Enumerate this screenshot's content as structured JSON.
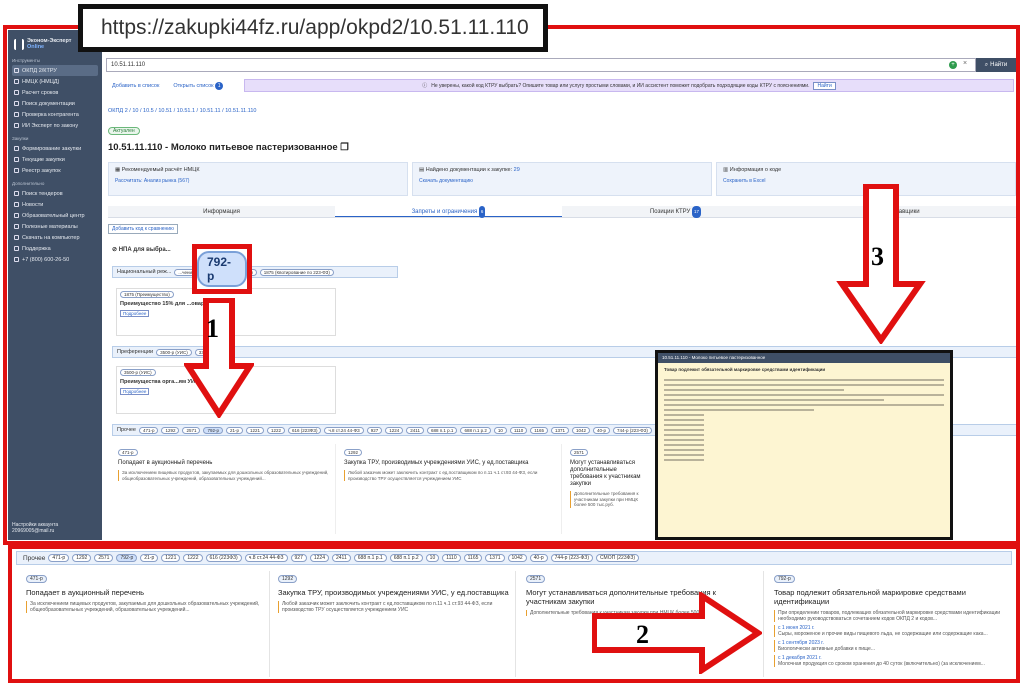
{
  "url": "https://zakupki44fz.ru/app/okpd2/10.51.11.110",
  "sidebar": {
    "logo_top": "Эконом-Эксперт",
    "logo_sub": "Online",
    "sections": {
      "tools": "Инструменты",
      "purchases": "Закупки",
      "extra": "Дополнительно"
    },
    "tools": [
      "ОКПД 2/КТРУ",
      "НМЦК (НМЦД)",
      "Расчет сроков",
      "Поиск документации",
      "Проверка контрагента",
      "ИИ Эксперт по закону"
    ],
    "purchases": [
      "Формирование закупки",
      "Текущие закупки",
      "Реестр закупок"
    ],
    "extra": [
      "Поиск тендеров",
      "Новости",
      "Образовательный центр",
      "Полезные материалы",
      "Скачать на компьютер",
      "Поддержка",
      "+7 (800) 600-26-50"
    ],
    "account_title": "Настройки аккаунта",
    "account_email": "20969005@mail.ru"
  },
  "search": {
    "value": "10.51.11.110",
    "button": "Найти"
  },
  "links": {
    "add": "Добавить в список",
    "open": "Открыть список",
    "open_count": "1"
  },
  "hint": {
    "text": "Не уверены, какой код КТРУ выбрать? Опишите товар или услугу простыми словами, и ИИ ассистент поможет подобрать подходящие коды КТРУ с пояснениями.",
    "button": "Найти"
  },
  "breadcrumbs": "ОКПД 2 / 10 / 10.5 / 10.51 / 10.51.1 / 10.51.11 / 10.51.11.110",
  "status": "Актуален",
  "title": "10.51.11.110 - Молоко питьевое пастеризованное",
  "cards": [
    {
      "title": "Рекомендуемый расчёт НМЦК",
      "link": "Рассчитать: Анализ рынка (567)"
    },
    {
      "title": "Найдено документации к закупке:",
      "count": "29",
      "link": "Скачать документацию"
    },
    {
      "title": "Информация о коде",
      "link": "Сохранить в Excel"
    }
  ],
  "tabs": [
    {
      "label": "Информация"
    },
    {
      "label": "Запреты и ограничения",
      "badge": "6"
    },
    {
      "label": "Позиции КТРУ",
      "badge": "17"
    },
    {
      "label": "Поставщики"
    }
  ],
  "add_compare": "Добавить код к сравнению",
  "npa_title": "НПА для выбра...",
  "national": {
    "label": "Национальный реж...",
    "chips": [
      "...чение)",
      "1875 (Преимущество)",
      "1875 (Квотирование по 223-ФЗ)"
    ]
  },
  "national_card": {
    "chip": "1875 (Преимущество)",
    "title": "Преимущество 15% для ...оваров",
    "btn": "Подробнее"
  },
  "preferences": {
    "label": "Преференции",
    "chips": [
      "3500-р (УИС)",
      "3387-р (ОИ)"
    ]
  },
  "pref_card": {
    "chip": "3500-р (УИС)",
    "title": "Преимущества орга...ям УИС",
    "btn": "Подробнее"
  },
  "other": {
    "label": "Прочее",
    "chips": [
      "471-р",
      "1292",
      "2571",
      "792-р",
      "21-р",
      "1221",
      "1222",
      "616 (223ФЗ)",
      "ч.8 ст.24 44-ФЗ",
      "927",
      "1224",
      "2411",
      "688 п.1 р.1",
      "688 п.1 р.2",
      "10",
      "1110",
      "1165",
      "1371",
      "1042",
      "40-р",
      "744-р (223-ФЗ)",
      "СМОП (223ФЗ)"
    ],
    "selected": "792-р"
  },
  "callout_chip": "792-р",
  "labels": {
    "one": "1",
    "two": "2",
    "three": "3"
  },
  "popup": {
    "title": "10.51.11.110 - Молоко питьевое пастеризованное",
    "heading": "Товар подлежит обязательной маркировке средствами идентификации"
  },
  "other_cards": [
    {
      "chip": "471-р",
      "title": "Попадает в аукционный перечень",
      "desc": "За исключением пищевых продуктов, закупаемых для дошкольных образовательных учреждений, общеобразовательных учреждений, образовательных учреждений..."
    },
    {
      "chip": "1292",
      "title": "Закупка ТРУ, производимых учреждениями УИС, у ед.поставщика",
      "desc": "Любой заказчик может заключить контракт с ед.поставщиком по п.11 ч.1 ст.93 44-ФЗ, если производство ТРУ осуществляется учреждением УИС"
    },
    {
      "chip": "2571",
      "title": "Могут устанавливаться дополнительные требования к участникам закупки",
      "desc": "Дополнительные требования к участникам закупки при НМЦК более 500 тыс.руб."
    },
    {
      "chip": "792-р",
      "title": "Товар подлежит обязательной маркировке средствами идентификации",
      "desc": "При определении товаров, подлежащих обязательной маркировке средствами идентификации необходимо руководствоваться сочетанием кодов ОКПД 2 и кодов..."
    }
  ],
  "marking_dates": [
    {
      "date": "с 1 июня 2021 г.",
      "text": "Сыры, мороженое и прочие виды пищевого льда, не содержащие или содержащие кака..."
    },
    {
      "date": "с 1 сентября 2023 г.",
      "text": "Биологически активные добавки к пище..."
    },
    {
      "date": "с 1 декабря 2021 г.",
      "text": "Молочная продукция со сроком хранения до 40 суток (включительно) (за исключением..."
    }
  ]
}
